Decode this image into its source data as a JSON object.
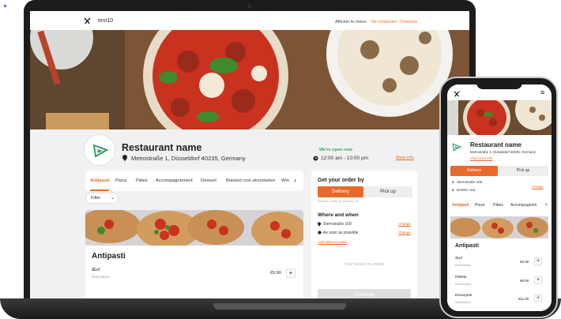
{
  "laptop": {
    "nav": {
      "title": "test10",
      "show_menu": "Afficher le menu",
      "login": "Se connecter",
      "signup": "S'inscrire"
    },
    "restaurant": {
      "name": "Restaurant name",
      "address": "Metrostraße 1, Düsseldorf 40235, Germany",
      "open_status": "We're open now",
      "hours": "12:00 am - 10:00 pm",
      "more_info": "More info"
    },
    "tabs": [
      "Antipasti",
      "Pizza",
      "Pâtes",
      "Accompagnement",
      "Dessert",
      "Boisson non alcoolisées",
      "Wine"
    ],
    "filter": "Filter",
    "section_title": "Antipasti",
    "items": [
      {
        "name": "Œuf",
        "desc": "Description",
        "price": "€9.90"
      }
    ],
    "order": {
      "title": "Get your order by",
      "delivery": "Delivery",
      "pickup": "Pick up",
      "min_order": "Minimum order for delivery: 38",
      "where_when": "Where and when",
      "address": "Sternstraße 100",
      "time": "As soon as possible",
      "change": "Change",
      "add_notes": "Add delivery notes",
      "empty": "Your basket is empty",
      "checkout": "Checkout"
    }
  },
  "phone": {
    "restaurant_name": "Restaurant name",
    "address": "Metrostraße 1, Düsseldorf 40235, Germany",
    "more_info": "View more info",
    "delivery": "Delivery",
    "pickup": "Pick up",
    "addr": "Sternstraße 100",
    "time": "Deliver now",
    "change": "Change",
    "tabs": [
      "Antipasti",
      "Pizza",
      "Pâtes",
      "Accompagnem"
    ],
    "section_title": "Antipasti",
    "items": [
      {
        "name": "Œuf",
        "desc": "Description",
        "price": "€9.90"
      },
      {
        "name": "Rillette",
        "desc": "Description",
        "price": "€9.50"
      },
      {
        "name": "Escargots",
        "desc": "Description",
        "price": "€11.90"
      }
    ]
  },
  "colors": {
    "accent": "#e8692a",
    "green": "#2daa4f",
    "logo_green": "#3a9d6a"
  }
}
